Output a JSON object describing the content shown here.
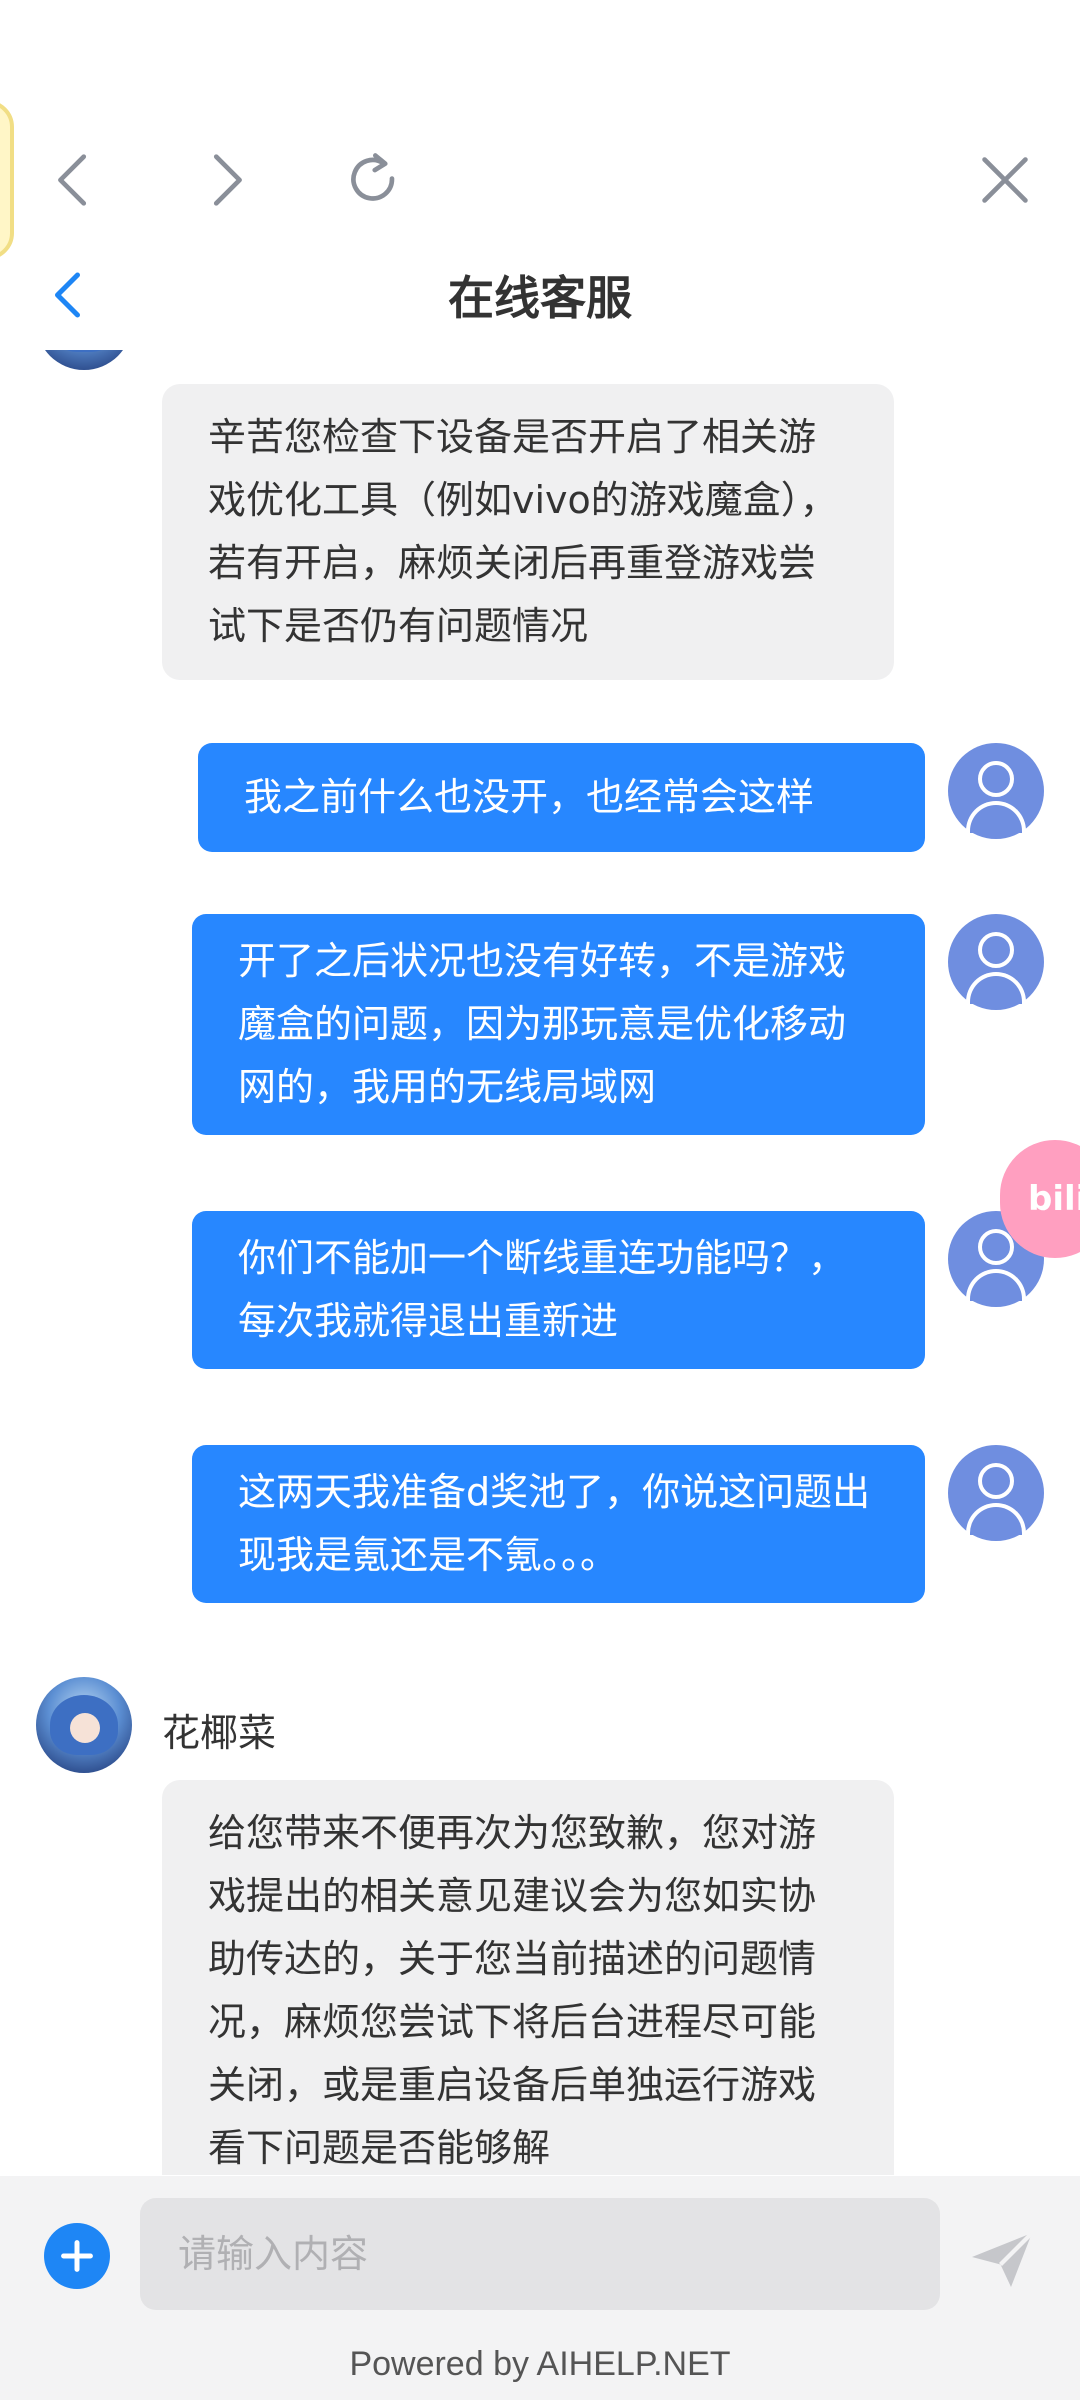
{
  "header": {
    "title": "在线客服"
  },
  "chat": {
    "messages": [
      {
        "side": "in",
        "text": "辛苦您检查下设备是否开启了相关游戏优化工具（例如vivo的游戏魔盒），若有开启，麻烦关闭后再重登游戏尝试下是否仍有问题情况"
      },
      {
        "side": "out",
        "text": "我之前什么也没开，也经常会这样"
      },
      {
        "side": "out",
        "text": "开了之后状况也没有好转，不是游戏魔盒的问题，因为那玩意是优化移动网的，我用的无线局域网"
      },
      {
        "side": "out",
        "text": "你们不能加一个断线重连功能吗？，每次我就得退出重新进"
      },
      {
        "side": "out",
        "text": "这两天我准备d奖池了，你说这问题出现我是氪还是不氪。。。"
      },
      {
        "side": "in",
        "agent_name": "花椰菜",
        "text": "给您带来不便再次为您致歉，您对游戏提出的相关意见建议会为您如实协助传达的，关于您当前描述的问题情况，麻烦您尝试下将后台进程尽可能关闭，或是重启设备后单独运行游戏看下问题是否能够解"
      }
    ]
  },
  "float_tab": {
    "label": "bili"
  },
  "input": {
    "placeholder": "请输入内容"
  },
  "footer": {
    "powered_by": "Powered by AIHELP.NET"
  },
  "colors": {
    "accent": "#2787ff",
    "incoming_bubble": "#f0f0f1",
    "avatar_user": "#6f8ee0",
    "plus_button": "#1e86f5"
  },
  "icons": {
    "back_nav": "chevron-left-icon",
    "forward_nav": "chevron-right-icon",
    "refresh": "refresh-icon",
    "close": "close-icon",
    "header_back": "chevron-left-icon",
    "add": "plus-icon",
    "send": "send-icon"
  }
}
